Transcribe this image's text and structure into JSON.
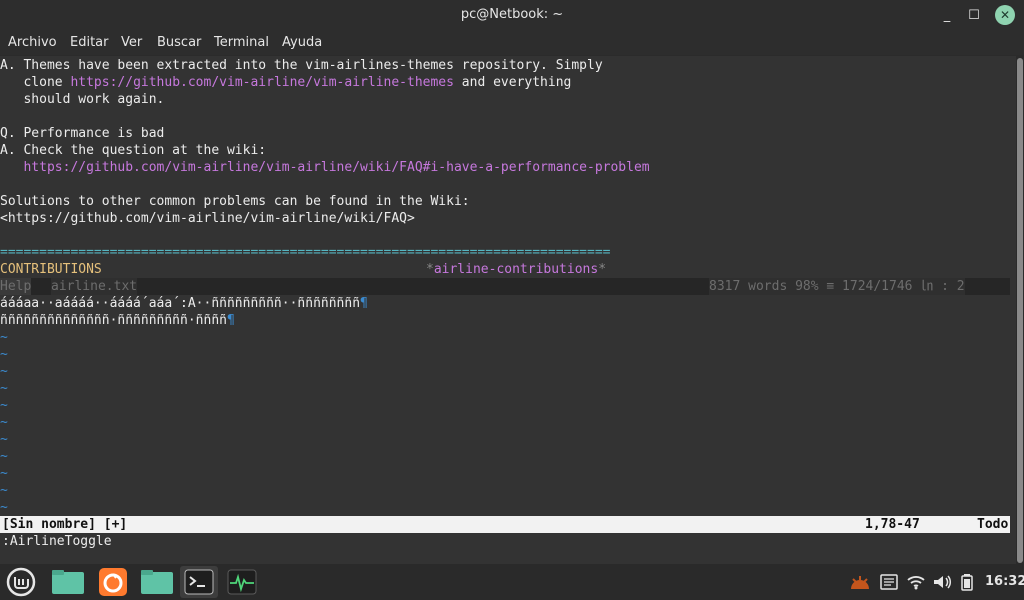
{
  "window": {
    "title": "pc@Netbook: ~"
  },
  "menu": [
    "Archivo",
    "Editar",
    "Ver",
    "Buscar",
    "Terminal",
    "Ayuda"
  ],
  "help_text": {
    "line1": "A. Themes have been extracted into the vim-airlines-themes repository. Simply",
    "line2_pre": "   clone ",
    "line2_link": "https://github.com/vim-airline/vim-airline-themes",
    "line2_post": " and everything",
    "line3": "   should work again.",
    "line5": "Q. Performance is bad",
    "line6": "A. Check the question at the wiki:",
    "line7_pre": "   ",
    "line7_link": "https://github.com/vim-airline/vim-airline/wiki/FAQ#i-have-a-performance-problem",
    "line9": "Solutions to other common problems can be found in the Wiki:",
    "line10": "<https://github.com/vim-airline/vim-airline/wiki/FAQ>",
    "separator": "==============================================================================",
    "contrib_left": "CONTRIBUTIONS",
    "contrib_tag_star1": "*",
    "contrib_tag": "airline-contributions",
    "contrib_tag_star2": "*"
  },
  "tabline": {
    "help": " Help ",
    "file": " airline.txt ",
    "stats": "8317 words   98% ≡ 1724/1746 ㏑ :  2 "
  },
  "buffer": {
    "row1": "áááaa··aáááá··áááá´aáa´:A··ñññññññññ··ññññññññ",
    "row1_mark": "¶",
    "row2": "ññññññññññññññ·ñññññññññ·ññññ",
    "row2_mark": "¶",
    "tildes": [
      "~",
      "~",
      "~",
      "~",
      "~",
      "~",
      "~",
      "~",
      "~",
      "~",
      "~"
    ]
  },
  "statusline": {
    "left": "[Sin nombre] [+]",
    "position": "1,78-47",
    "scroll": "Todo"
  },
  "command_line": ":AirlineToggle",
  "taskbar": {
    "clock": "16:32",
    "icons": [
      "mint-menu-icon",
      "files-folder-icon",
      "firefox-icon",
      "folder-icon",
      "terminal-icon",
      "system-monitor-icon"
    ]
  },
  "colors": {
    "accent": "#8fd3b0",
    "link": "#c678dd",
    "separator": "#56b6c2",
    "heading": "#e5c07b"
  }
}
